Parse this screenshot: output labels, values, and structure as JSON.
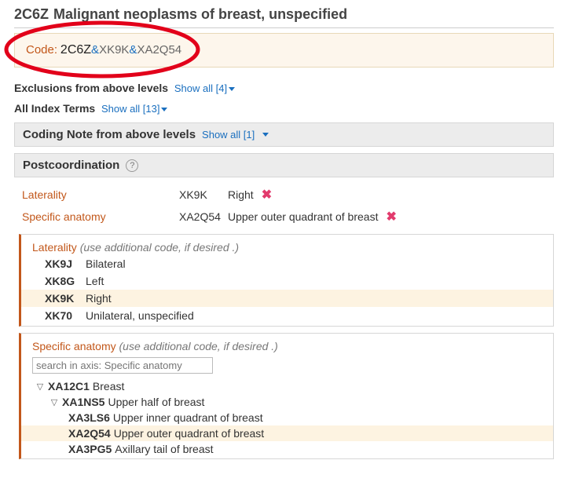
{
  "header": {
    "code": "2C6Z",
    "title": "Malignant neoplasms of breast, unspecified"
  },
  "code_display": {
    "label": "Code:",
    "main": "2C6Z",
    "post1": "XK9K",
    "post2": "XA2Q54",
    "amp": "&"
  },
  "exclusions": {
    "label": "Exclusions from above levels",
    "link": "Show all [4]"
  },
  "index_terms": {
    "label": "All Index Terms",
    "link": "Show all [13]"
  },
  "coding_note": {
    "label": "Coding Note from above levels",
    "link": "Show all [1]"
  },
  "postcoord": {
    "label": "Postcoordination",
    "rows": [
      {
        "axis": "Laterality",
        "code": "XK9K",
        "term": "Right"
      },
      {
        "axis": "Specific anatomy",
        "code": "XA2Q54",
        "term": "Upper outer quadrant of breast"
      }
    ]
  },
  "laterality_axis": {
    "name": "Laterality",
    "hint": "(use additional code, if desired .)",
    "options": [
      {
        "code": "XK9J",
        "term": "Bilateral",
        "selected": false
      },
      {
        "code": "XK8G",
        "term": "Left",
        "selected": false
      },
      {
        "code": "XK9K",
        "term": "Right",
        "selected": true
      },
      {
        "code": "XK70",
        "term": "Unilateral, unspecified",
        "selected": false
      }
    ]
  },
  "anatomy_axis": {
    "name": "Specific anatomy",
    "hint": "(use additional code, if desired .)",
    "search_placeholder": "search in axis: Specific anatomy",
    "tree": {
      "l1": {
        "tog": "▽",
        "code": "XA12C1",
        "term": "Breast"
      },
      "l2": {
        "tog": "▽",
        "code": "XA1NS5",
        "term": "Upper half of breast"
      },
      "l3a": {
        "code": "XA3LS6",
        "term": "Upper inner quadrant of breast",
        "selected": false
      },
      "l3b": {
        "code": "XA2Q54",
        "term": "Upper outer quadrant of breast",
        "selected": true
      },
      "l3c": {
        "code": "XA3PG5",
        "term": "Axillary tail of breast",
        "selected": false
      }
    }
  }
}
